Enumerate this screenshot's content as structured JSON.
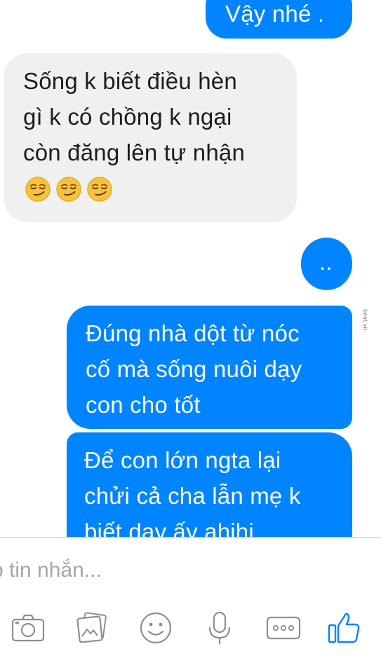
{
  "messages": [
    {
      "direction": "outgoing",
      "lines": [
        "Vậy nhé ."
      ]
    },
    {
      "direction": "incoming",
      "lines": [
        "Sống k biết điều hèn",
        "gì k có chồng k ngại",
        "còn đăng lên tự nhận"
      ],
      "emojis": [
        "smirking-face",
        "smirking-face",
        "smirking-face"
      ]
    },
    {
      "direction": "outgoing",
      "lines": [
        ".."
      ]
    },
    {
      "direction": "outgoing",
      "lines": [
        "Đúng nhà dột từ nóc",
        "cố mà sống nuôi dạy",
        "con cho tốt"
      ]
    },
    {
      "direction": "outgoing",
      "lines": [
        "Để con lớn ngta lại",
        "chửi cả cha lẫn mẹ k",
        "biết dạy ấy ahihi"
      ]
    }
  ],
  "watermark": "beat.vn",
  "composer": {
    "placeholder": "p tin nhắn..."
  },
  "toolbar": {
    "icons": [
      "camera-icon",
      "photo-gallery-icon",
      "sticker-smiley-icon",
      "microphone-icon",
      "more-icon",
      "like-thumbs-up-icon"
    ]
  },
  "colors": {
    "outgoing_bubble": "#0084ff",
    "incoming_bubble": "#f1f0f0",
    "icon_gray": "#8e8e93",
    "accent": "#0084ff"
  }
}
